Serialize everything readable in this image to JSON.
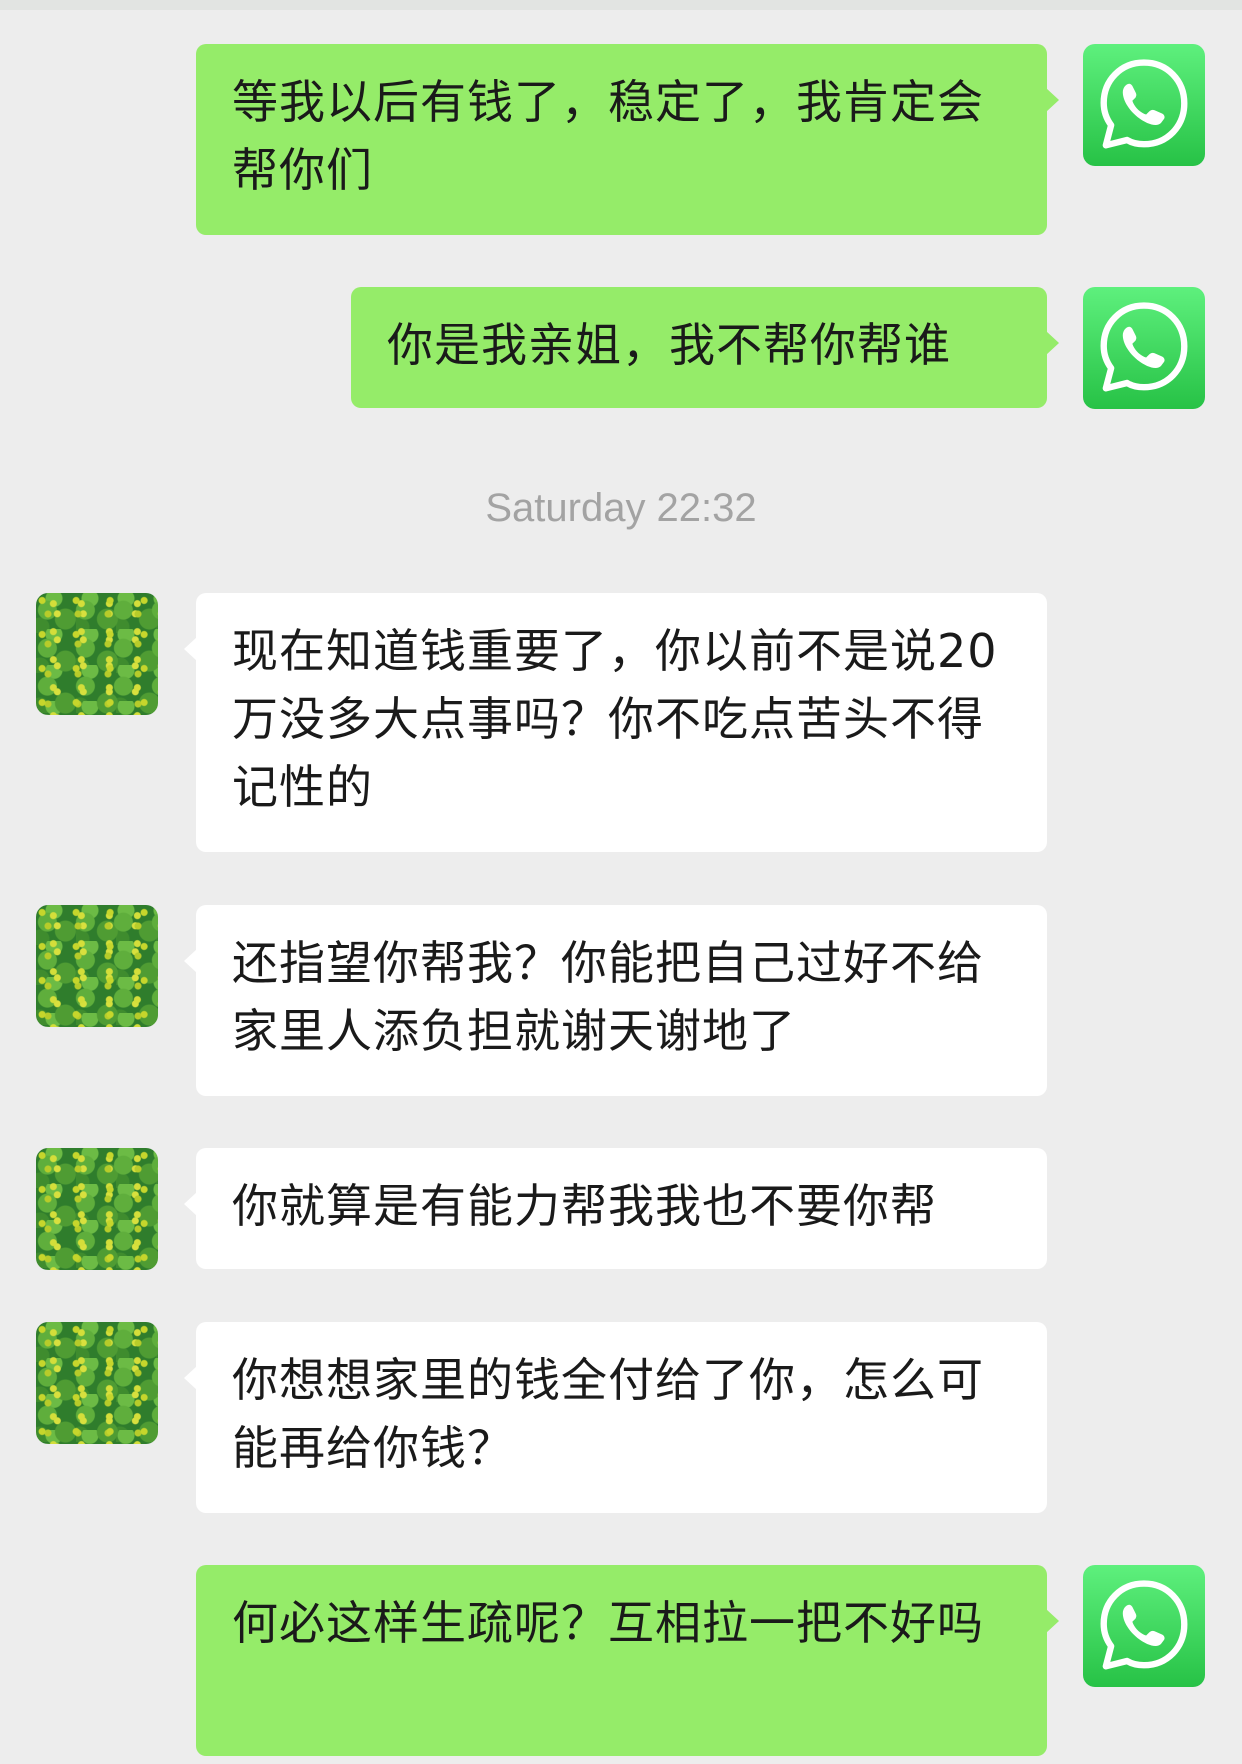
{
  "chat": {
    "messages": [
      {
        "side": "out",
        "text": "等我以后有钱了，稳定了，我肯定会帮你们",
        "avatar_icon": "whatsapp-icon"
      },
      {
        "side": "out",
        "text": "你是我亲姐，我不帮你帮谁",
        "avatar_icon": "whatsapp-icon"
      },
      {
        "side": "in",
        "text": "现在知道钱重要了，你以前不是说20万没多大点事吗？你不吃点苦头不得记性的",
        "avatar_icon": "leaf-avatar"
      },
      {
        "side": "in",
        "text": "还指望你帮我？你能把自己过好不给家里人添负担就谢天谢地了",
        "avatar_icon": "leaf-avatar"
      },
      {
        "side": "in",
        "text": "你就算是有能力帮我我也不要你帮",
        "avatar_icon": "leaf-avatar"
      },
      {
        "side": "in",
        "text": "你想想家里的钱全付给了你，怎么可能再给你钱？",
        "avatar_icon": "leaf-avatar"
      },
      {
        "side": "out",
        "text": "何必这样生疏呢？互相拉一把不好吗",
        "avatar_icon": "whatsapp-icon"
      }
    ],
    "timestamp": "Saturday 22:32"
  },
  "colors": {
    "background": "#ededed",
    "outgoing_bubble": "#95ec69",
    "incoming_bubble": "#ffffff",
    "timestamp_text": "#a3a3a3",
    "whatsapp_green": "#27c246"
  }
}
